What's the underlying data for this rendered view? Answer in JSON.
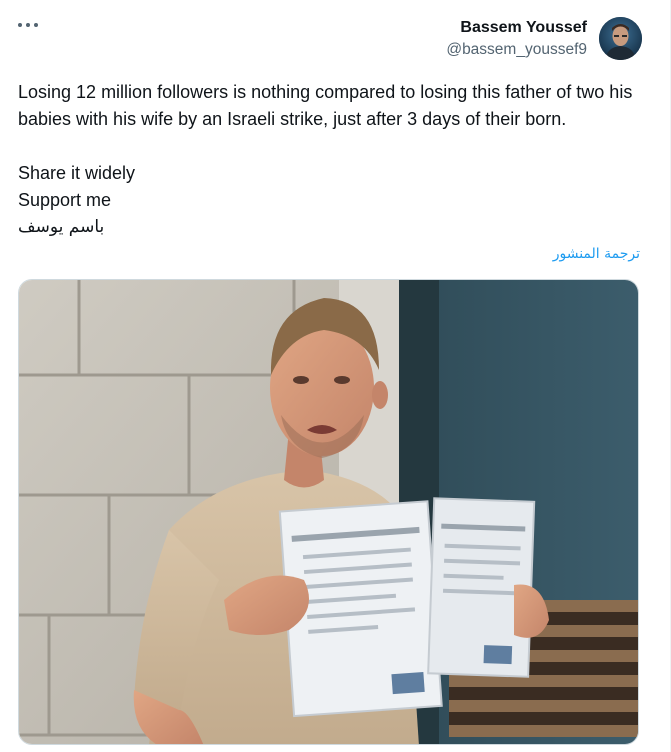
{
  "tweet": {
    "author_name": "Bassem Youssef",
    "author_handle": "@bassem_youssef9",
    "text_line1": "Losing 12 million followers is nothing compared to losing this father of two his babies with his wife by an Israeli strike, just after 3 days of their born.",
    "text_line2": "Share it widely",
    "text_line3": "Support me",
    "text_line4": "باسم يوسف",
    "translate_label": "ترجمة المنشور"
  },
  "icons": {
    "more": "more-horizontal-icon"
  },
  "colors": {
    "link": "#1d9bf0",
    "secondary_text": "#536471",
    "primary_text": "#0f1419"
  }
}
